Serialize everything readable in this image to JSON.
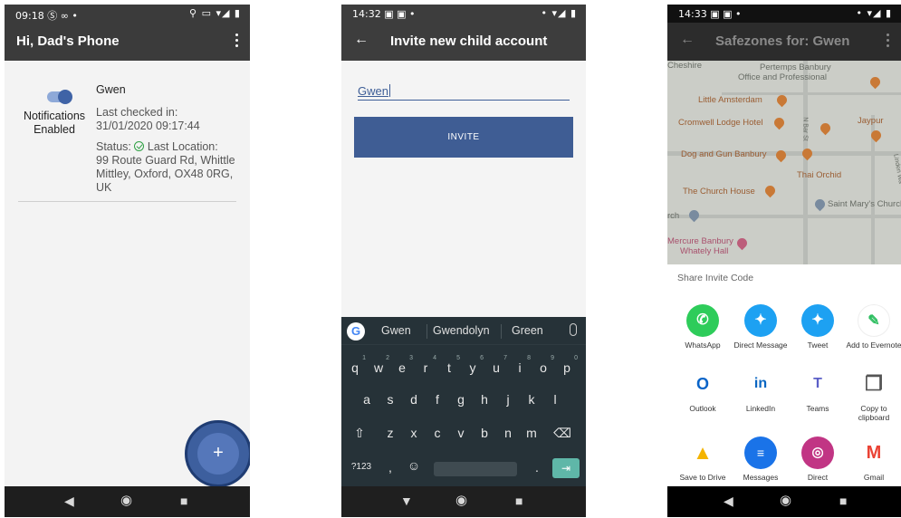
{
  "phone1": {
    "status_time": "09:18",
    "status_icons_left": "Ⓢ ∞ •",
    "status_icons_right": "⚲ ▭ ▾◢ ▮",
    "title": "Hi, Dad's Phone",
    "card": {
      "toggle_label": "Notifications Enabled",
      "name": "Gwen",
      "last_checked_label": "Last checked in:",
      "last_checked_value": "31/01/2020 09:17:44",
      "status_label": "Status:",
      "last_location_label": "Last Location:",
      "address": "99 Route Guard Rd, Whittle Mittley, Oxford, OX48 0RG, UK"
    },
    "fab_label": "+"
  },
  "phone2": {
    "status_time": "14:32",
    "status_icons_left": "▣ ▣ •",
    "status_icons_right": "• ▾◢ ▮",
    "title": "Invite new child account",
    "input_value": "Gwen",
    "invite_label": "INVITE",
    "suggestions": [
      "Gwen",
      "Gwendolyn",
      "Green"
    ],
    "keyboard": {
      "row1": [
        "q",
        "w",
        "e",
        "r",
        "t",
        "y",
        "u",
        "i",
        "o",
        "p"
      ],
      "row1_hints": [
        "1",
        "2",
        "3",
        "4",
        "5",
        "6",
        "7",
        "8",
        "9",
        "0"
      ],
      "row2": [
        "a",
        "s",
        "d",
        "f",
        "g",
        "h",
        "j",
        "k",
        "l"
      ],
      "row3": [
        "z",
        "x",
        "c",
        "v",
        "b",
        "n",
        "m"
      ],
      "symbols_label": "?123",
      "comma": ",",
      "period": "."
    }
  },
  "phone3": {
    "status_time": "14:33",
    "status_icons_left": "▣ ▣ •",
    "status_icons_right": "• ▾◢ ▮",
    "title": "Safezones for: Gwen",
    "map_labels": {
      "l1": "Pertemps Banbury",
      "l1b": "Office and Professional",
      "l2": "Little Amsterdam",
      "l3": "Cromwell Lodge Hotel",
      "l4": "Jaypur",
      "l5": "Dog and Gun Banbury",
      "l6": "Thai Orchid",
      "l7": "The Church House",
      "l8": "Saint Mary's Church",
      "l9": "Mercure Banbury",
      "l9b": "Whately Hall",
      "l10": "Cheshire",
      "l11": "rch",
      "l12": "N Bar St",
      "l13": "Linden Wa"
    },
    "sheet_title": "Share Invite Code",
    "apps": [
      {
        "label": "WhatsApp"
      },
      {
        "label": "Direct Message"
      },
      {
        "label": "Tweet"
      },
      {
        "label": "Add to Evernote"
      },
      {
        "label": "Outlook"
      },
      {
        "label": "LinkedIn"
      },
      {
        "label": "Teams"
      },
      {
        "label": "Copy to clipboard"
      },
      {
        "label": "Save to Drive"
      },
      {
        "label": "Messages"
      },
      {
        "label": "Direct"
      },
      {
        "label": "Gmail"
      }
    ]
  },
  "colors": {
    "accent": "#3f5d94",
    "fab": "#5577ba",
    "keyboard": "#263238",
    "enter_key": "#5fb7a8"
  }
}
